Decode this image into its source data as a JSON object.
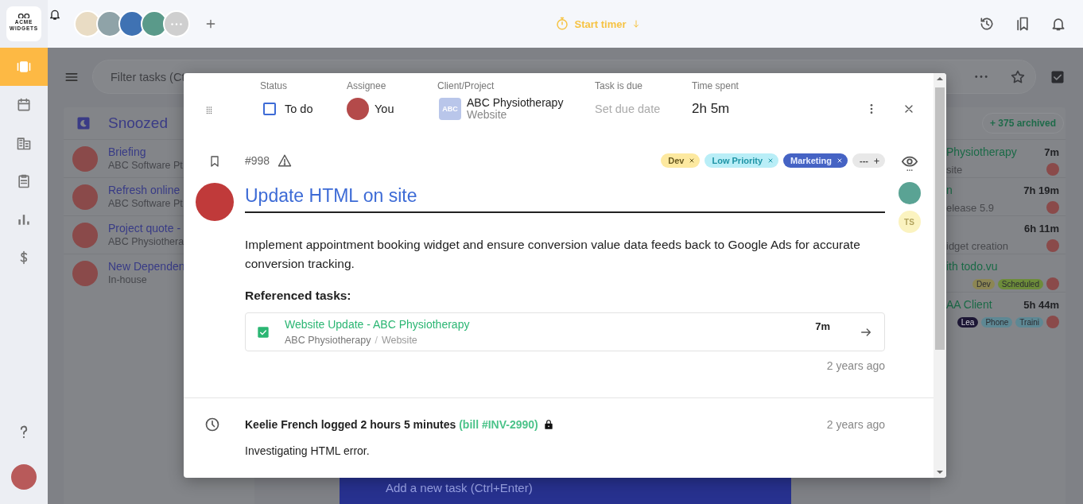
{
  "sidebar": {
    "logo_text": "ACME WIDGETS",
    "items": [
      {
        "kind": "board",
        "selected": true
      },
      {
        "kind": "calendar",
        "selected": false
      },
      {
        "kind": "building",
        "selected": false
      },
      {
        "kind": "clipboard",
        "selected": false
      },
      {
        "kind": "chart",
        "selected": false
      },
      {
        "kind": "dollar",
        "selected": false
      }
    ]
  },
  "topbar": {
    "team": [
      {
        "kind": "photo"
      },
      {
        "kind": "photo"
      },
      {
        "kind": "photo"
      },
      {
        "kind": "photo"
      },
      {
        "kind": "more"
      }
    ],
    "timer": {
      "label": "Start timer"
    }
  },
  "filter": {
    "placeholder": "Filter tasks (Ct"
  },
  "snoozed": {
    "title": "Snoozed",
    "tasks": [
      {
        "title": "Briefing",
        "subtitle": "ABC Software Pt"
      },
      {
        "title": "Refresh online",
        "subtitle": "ABC Software Pt"
      },
      {
        "title": "Project quote -",
        "subtitle": "ABC Physiothera"
      },
      {
        "title": "New Dependen",
        "subtitle": "In-house"
      }
    ]
  },
  "done_column": {
    "archived": "+ 375 archived",
    "tasks": [
      {
        "title": "Physiotherapy",
        "time": "7m",
        "subtitle": "site"
      },
      {
        "title": "n",
        "time": "7h 19m",
        "subtitle": "elease 5.9"
      },
      {
        "time": "6h 11m",
        "subtitle": "idget creation"
      },
      {
        "title": "ith todo.vu",
        "tags": [
          {
            "label": "Dev",
            "color": "#8c8654"
          },
          {
            "label": "Scheduled",
            "color": "#6d8c3a"
          }
        ]
      },
      {
        "title": "AA Client",
        "time": "5h 44m",
        "tags": [
          {
            "label": "Lea",
            "color": "#1d1735"
          },
          {
            "label": "Phone",
            "color": "#5e8894"
          },
          {
            "label": "Traini",
            "color": "#5e8894"
          }
        ]
      }
    ]
  },
  "add_task": {
    "placeholder": "Add a new task (Ctrl+Enter)"
  },
  "task": {
    "status": {
      "label": "Status",
      "value": "To do",
      "checked": false
    },
    "assignee": {
      "label": "Assignee",
      "value": "You"
    },
    "client": {
      "label": "Client/Project",
      "badge": "ABC",
      "client": "ABC Physiotherapy",
      "project": "Website"
    },
    "due": {
      "label": "Task is due",
      "placeholder": "Set due date"
    },
    "time_spent": {
      "label": "Time spent",
      "value": "2h 5m"
    },
    "number": "#998",
    "tags": [
      {
        "label": "Dev",
        "color": "#fde9a0"
      },
      {
        "label": "Low Priority",
        "color": "#b9eef7"
      },
      {
        "label": "Marketing",
        "color": "#4563c4"
      }
    ],
    "more_tags": "---",
    "title": "Update HTML on site",
    "watchers": [
      {
        "kind": "photo"
      },
      {
        "kind": "initials",
        "initials": "TS"
      }
    ],
    "description": "Implement appointment booking widget and ensure conversion value data feeds back to Google Ads for accurate conversion tracking.",
    "referenced_heading": "Referenced tasks:",
    "referenced": [
      {
        "title": "Website Update - ABC Physiotherapy",
        "client": "ABC Physiotherapy",
        "separator": "/",
        "project": "Website",
        "time": "7m",
        "done": true
      }
    ],
    "updated": "2 years ago",
    "activity": [
      {
        "text": "Keelie French logged 2 hours 5 minutes",
        "bill": "(bill #INV-2990)",
        "locked": true,
        "time": "2 years ago",
        "note": "Investigating HTML error."
      }
    ]
  }
}
